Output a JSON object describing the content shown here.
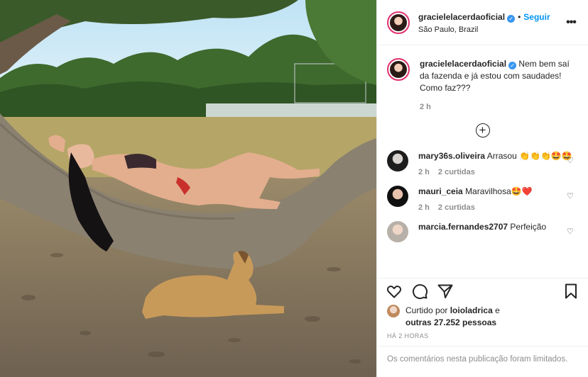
{
  "post": {
    "image_alt": "",
    "header": {
      "username": "gracielelacerdaoficial",
      "verified": true,
      "separator": "•",
      "follow_label": "Seguir",
      "location": "São Paulo, Brazil",
      "more_label": "•••"
    },
    "caption": {
      "username": "gracielelacerdaoficial",
      "text": "Nem bem saí da fazenda e já estou com saudades! Como faz???",
      "time": "2 h"
    },
    "load_more_label": "+",
    "comments": [
      {
        "username": "mary36s.oliveira",
        "text": "Arrasou 👏👏👏🤩🤩",
        "time": "2 h",
        "likes": "2 curtidas"
      },
      {
        "username": "mauri_ceia",
        "text": "Maravilhosa🤩❤️",
        "time": "2 h",
        "likes": "2 curtidas"
      },
      {
        "username": "marcia.fernandes2707",
        "text": "Perfeição",
        "time": "",
        "likes": ""
      }
    ],
    "likes": {
      "prefix": "Curtido por",
      "liker": "loioladrica",
      "connector": "e",
      "others": "outras 27.252 pessoas"
    },
    "timestamp": "HÁ 2 HORAS",
    "comments_limited": "Os comentários nesta publicação foram limitados."
  },
  "icons": {
    "like": "heart-outline-icon",
    "comment": "comment-bubble-icon",
    "share": "paper-plane-icon",
    "save": "bookmark-icon",
    "verified": "verified-badge-icon",
    "more": "ellipsis-icon",
    "add": "plus-circle-icon"
  },
  "colors": {
    "accent": "#0095f6",
    "verified": "#3897f0",
    "text": "#262626",
    "muted": "#8e8e8e"
  }
}
